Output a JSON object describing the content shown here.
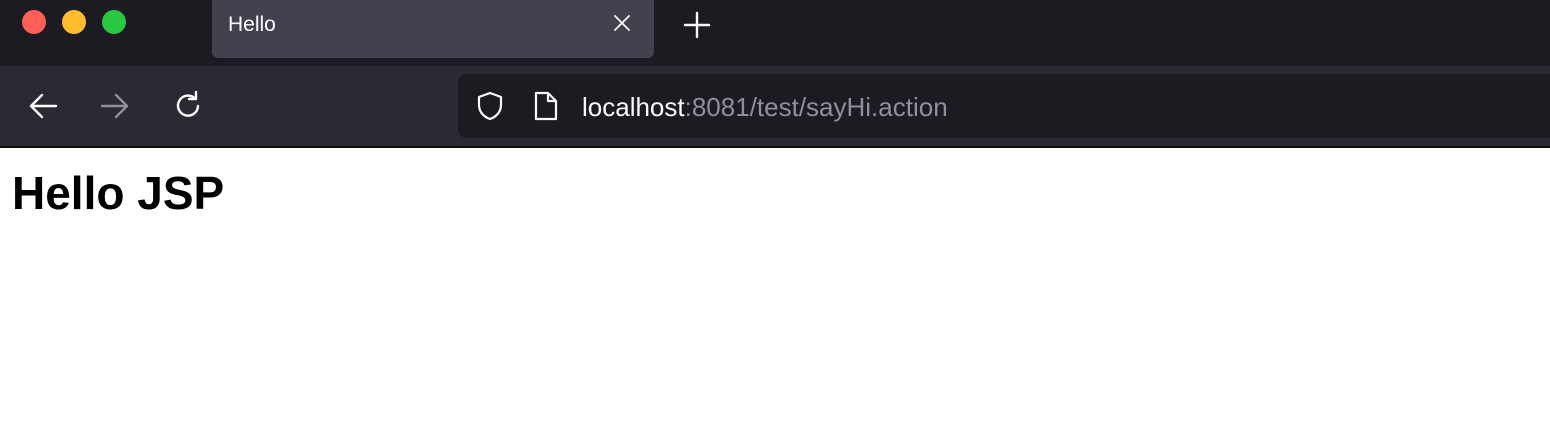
{
  "tab": {
    "title": "Hello"
  },
  "urlbar": {
    "host": "localhost",
    "rest": ":8081/test/sayHi.action"
  },
  "page": {
    "heading": "Hello JSP"
  },
  "icons": {
    "window_close": "window-close-button",
    "window_minimize": "window-minimize-button",
    "window_maximize": "window-maximize-button",
    "tab_close": "close-icon",
    "new_tab": "plus-icon",
    "back": "arrow-left-icon",
    "forward": "arrow-right-icon",
    "reload": "reload-icon",
    "tracking_protection": "shield-icon",
    "page_info": "document-icon"
  },
  "colors": {
    "tab_strip_bg": "#1c1b22",
    "active_tab_bg": "#42414d",
    "toolbar_bg": "#2b2a33",
    "urlbar_bg": "#1c1b22",
    "traffic_close": "#fe5f57",
    "traffic_minimize": "#febc2e",
    "traffic_maximize": "#28c840",
    "url_host": "#fbfbfe",
    "url_rest": "#8f8f9d"
  }
}
